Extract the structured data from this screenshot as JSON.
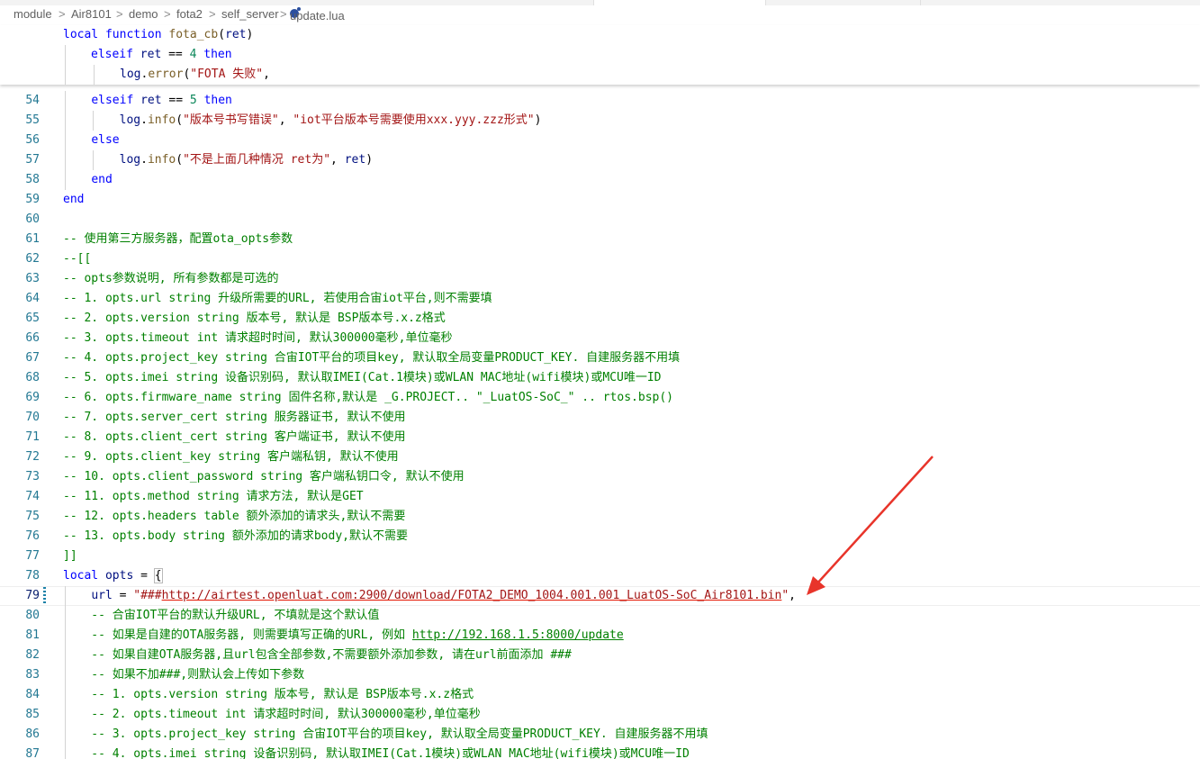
{
  "breadcrumb": {
    "items": [
      "module",
      "Air8101",
      "demo",
      "fota2",
      "self_server"
    ],
    "file": "update.lua",
    "separator": ">"
  },
  "topstrip_colors": {
    "base": "#f3f3f3",
    "active_tab": "#ffffff"
  },
  "sticky": {
    "line1": {
      "kw": "local function",
      "name": "fota_cb",
      "paren_open": "(",
      "param": "ret",
      "paren_close": ")"
    },
    "line2": {
      "kw": "elseif",
      "var": "ret",
      "op": "==",
      "num": "4",
      "kw2": "then"
    },
    "line3": {
      "obj": "log",
      "dot": ".",
      "fn": "error",
      "open": "(",
      "str": "\"FOTA 失败\"",
      "rest": ","
    }
  },
  "lines": [
    {
      "n": "54",
      "t": "    elseif ret == 5 then"
    },
    {
      "n": "55",
      "t": "        log.info(\"版本号书写错误\", \"iot平台版本号需要使用xxx.yyy.zzz形式\")"
    },
    {
      "n": "56",
      "t": "    else"
    },
    {
      "n": "57",
      "t": "        log.info(\"不是上面几种情况 ret为\", ret)"
    },
    {
      "n": "58",
      "t": "    end"
    },
    {
      "n": "59",
      "t": "end"
    },
    {
      "n": "60",
      "t": ""
    },
    {
      "n": "61",
      "t": "-- 使用第三方服务器，配置ota_opts参数"
    },
    {
      "n": "62",
      "t": "--[["
    },
    {
      "n": "63",
      "t": "-- opts参数说明, 所有参数都是可选的"
    },
    {
      "n": "64",
      "t": "-- 1. opts.url string 升级所需要的URL, 若使用合宙iot平台,则不需要填"
    },
    {
      "n": "65",
      "t": "-- 2. opts.version string 版本号, 默认是 BSP版本号.x.z格式"
    },
    {
      "n": "66",
      "t": "-- 3. opts.timeout int 请求超时时间, 默认300000毫秒,单位毫秒"
    },
    {
      "n": "67",
      "t": "-- 4. opts.project_key string 合宙IOT平台的项目key, 默认取全局变量PRODUCT_KEY. 自建服务器不用填"
    },
    {
      "n": "68",
      "t": "-- 5. opts.imei string 设备识别码, 默认取IMEI(Cat.1模块)或WLAN MAC地址(wifi模块)或MCU唯一ID"
    },
    {
      "n": "69",
      "t": "-- 6. opts.firmware_name string 固件名称,默认是 _G.PROJECT.. \"_LuatOS-SoC_\" .. rtos.bsp()"
    },
    {
      "n": "70",
      "t": "-- 7. opts.server_cert string 服务器证书, 默认不使用"
    },
    {
      "n": "71",
      "t": "-- 8. opts.client_cert string 客户端证书, 默认不使用"
    },
    {
      "n": "72",
      "t": "-- 9. opts.client_key string 客户端私钥, 默认不使用"
    },
    {
      "n": "73",
      "t": "-- 10. opts.client_password string 客户端私钥口令, 默认不使用"
    },
    {
      "n": "74",
      "t": "-- 11. opts.method string 请求方法, 默认是GET"
    },
    {
      "n": "75",
      "t": "-- 12. opts.headers table 额外添加的请求头,默认不需要"
    },
    {
      "n": "76",
      "t": "-- 13. opts.body string 额外添加的请求body,默认不需要"
    },
    {
      "n": "77",
      "t": "]]"
    },
    {
      "n": "78",
      "t": "local opts = {"
    },
    {
      "n": "79",
      "t": "    url = \"###http://airtest.openluat.com:2900/download/FOTA2_DEMO_1004.001.001_LuatOS-SoC_Air8101.bin\","
    },
    {
      "n": "80",
      "t": "    -- 合宙IOT平台的默认升级URL, 不填就是这个默认值"
    },
    {
      "n": "81",
      "t": "    -- 如果是自建的OTA服务器, 则需要填写正确的URL, 例如 http://192.168.1.5:8000/update"
    },
    {
      "n": "82",
      "t": "    -- 如果自建OTA服务器,且url包含全部参数,不需要额外添加参数, 请在url前面添加 ###"
    },
    {
      "n": "83",
      "t": "    -- 如果不加###,则默认会上传如下参数"
    },
    {
      "n": "84",
      "t": "    -- 1. opts.version string 版本号, 默认是 BSP版本号.x.z格式"
    },
    {
      "n": "85",
      "t": "    -- 2. opts.timeout int 请求超时时间, 默认300000毫秒,单位毫秒"
    },
    {
      "n": "86",
      "t": "    -- 3. opts.project_key string 合宙IOT平台的项目key, 默认取全局变量PRODUCT_KEY. 自建服务器不用填"
    },
    {
      "n": "87",
      "t": "    -- 4. opts.imei string 设备识别码, 默认取IMEI(Cat.1模块)或WLAN MAC地址(wifi模块)或MCU唯一ID"
    }
  ],
  "annotation_arrow_color": "#e8342a"
}
